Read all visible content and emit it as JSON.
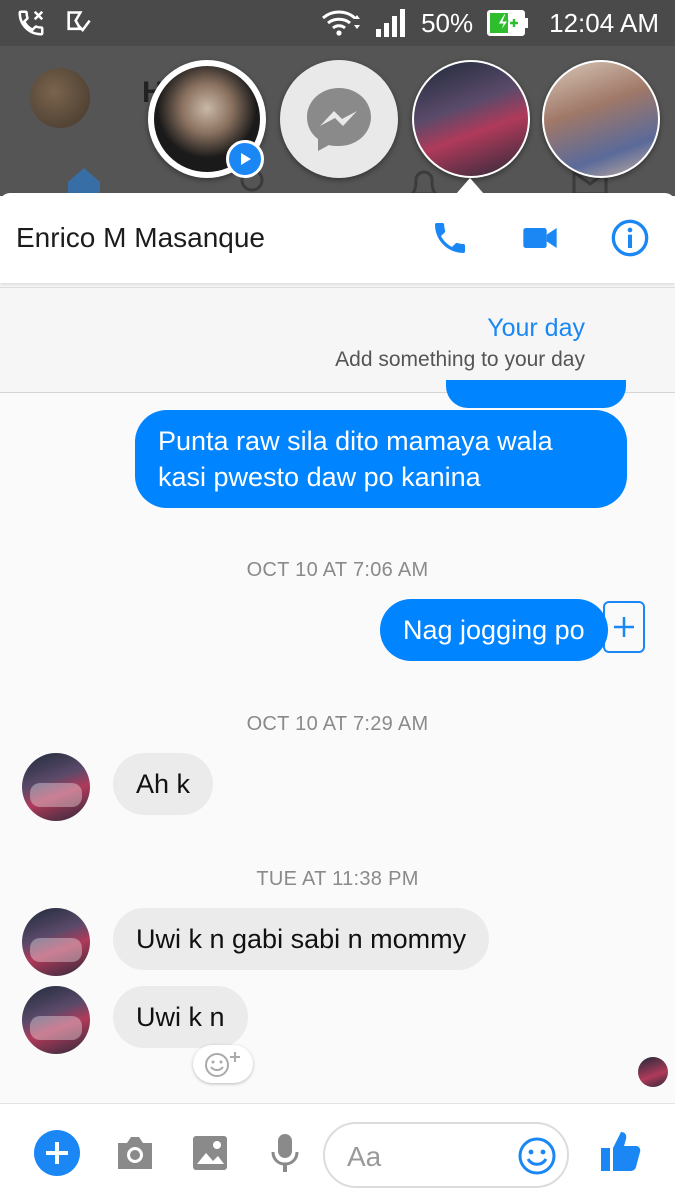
{
  "status_bar": {
    "battery": "50%",
    "time": "12:04 AM"
  },
  "background_partial_text": "H",
  "conversation": {
    "contact_name": "Enrico M Masanque"
  },
  "your_day": {
    "title": "Your day",
    "subtitle": "Add something to your day"
  },
  "messages": [
    {
      "type": "outgoing",
      "text": "Punta raw sila dito mamaya wala kasi pwesto daw po kanina"
    },
    {
      "type": "timestamp",
      "text": "OCT 10 AT 7:06 AM"
    },
    {
      "type": "outgoing",
      "text": "Nag jogging po"
    },
    {
      "type": "timestamp",
      "text": "OCT 10 AT 7:29 AM"
    },
    {
      "type": "incoming",
      "text": "Ah k"
    },
    {
      "type": "timestamp",
      "text": "TUE AT 11:38 PM"
    },
    {
      "type": "incoming",
      "text": "Uwi k n gabi sabi n mommy"
    },
    {
      "type": "incoming",
      "text": "Uwi k n"
    }
  ],
  "composer": {
    "placeholder": "Aa"
  },
  "colors": {
    "accent": "#0084ff",
    "incoming_bubble": "#ebebeb",
    "status_bar": "#4a4a4a"
  },
  "icons": [
    "missed-call-icon",
    "notification-icon",
    "wifi-icon",
    "signal-icon",
    "battery-icon",
    "phone-icon",
    "video-camera-icon",
    "info-icon",
    "add-story-icon",
    "plus-icon",
    "camera-icon",
    "gallery-icon",
    "microphone-icon",
    "emoji-icon",
    "thumbs-up-icon",
    "messenger-icon",
    "play-icon",
    "add-reaction-icon"
  ]
}
